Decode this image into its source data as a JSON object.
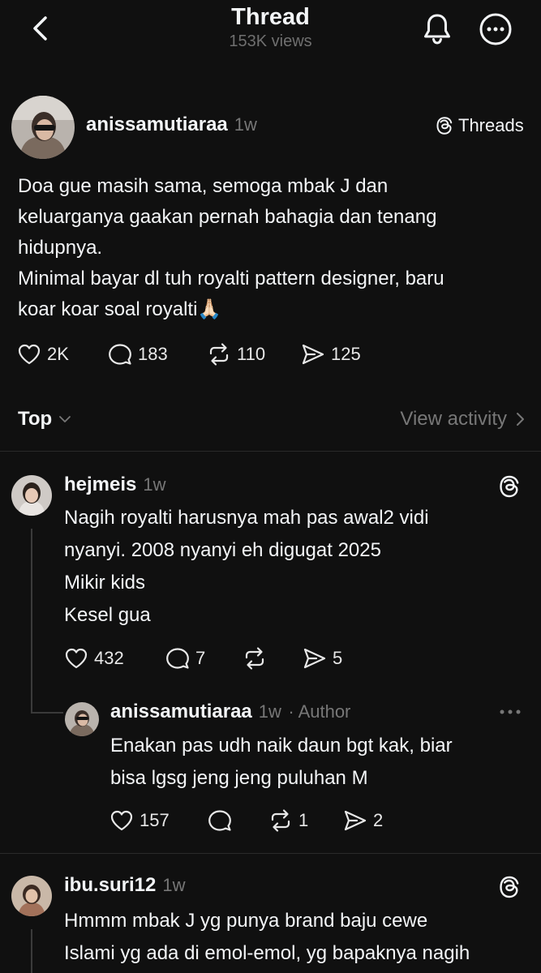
{
  "header": {
    "title": "Thread",
    "views": "153K views"
  },
  "main_post": {
    "username": "anissamutiaraa",
    "time": "1w",
    "source_label": "Threads",
    "lines": [
      "Doa gue masih sama, semoga mbak J dan",
      "keluarganya gaakan pernah bahagia dan tenang",
      "hidupnya.",
      "Minimal bayar dl tuh royalti pattern designer, baru",
      "koar koar soal royalti🙏🏻"
    ],
    "likes": "2K",
    "comments": "183",
    "reposts": "110",
    "shares": "125"
  },
  "sort": {
    "label": "Top",
    "activity": "View activity"
  },
  "replies": [
    {
      "username": "hejmeis",
      "time": "1w",
      "lines": [
        "Nagih royalti harusnya mah pas awal2 vidi",
        "nyanyi. 2008 nyanyi eh digugat 2025",
        "Mikir kids",
        "Kesel gua"
      ],
      "likes": "432",
      "comments": "7",
      "reposts": "",
      "shares": "5"
    },
    {
      "username": "anissamutiaraa",
      "time": "1w",
      "author_badge": "· Author",
      "lines": [
        "Enakan pas udh naik daun bgt kak, biar",
        "bisa lgsg jeng jeng puluhan M"
      ],
      "likes": "157",
      "comments": "",
      "reposts": "1",
      "shares": "2"
    },
    {
      "username": "ibu.suri12",
      "time": "1w",
      "lines": [
        "Hmmm mbak J yg punya brand baju cewe",
        "Islami yg ada di emol-emol, yg bapaknya nagih"
      ]
    }
  ]
}
